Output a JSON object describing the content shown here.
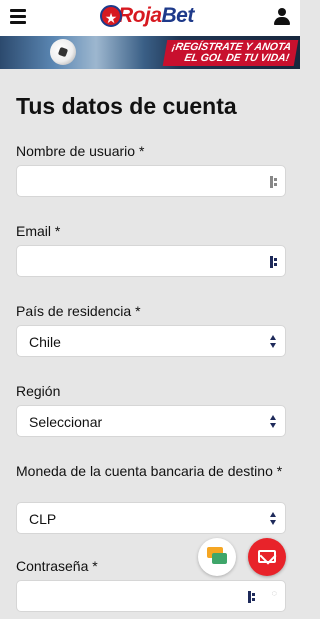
{
  "header": {
    "brand_roja": "Roja",
    "brand_bet": "Bet"
  },
  "banner": {
    "line1": "¡REGÍSTRATE Y ANOTA",
    "line2": "EL GOL DE TU VIDA!"
  },
  "form": {
    "title": "Tus datos de cuenta",
    "username_label": "Nombre de usuario *",
    "username_value": "",
    "email_label": "Email *",
    "email_value": "",
    "country_label": "País de residencia *",
    "country_value": "Chile",
    "region_label": "Región",
    "region_value": "Seleccionar",
    "currency_label": "Moneda de la cuenta bancaria de destino *",
    "currency_value": "CLP",
    "password_label": "Contraseña *",
    "password_value": ""
  },
  "icons": {
    "menu": "hamburger-menu-icon",
    "user": "user-icon",
    "chat": "chat-bubbles-icon",
    "mail": "envelope-icon",
    "password_manager": "password-manager-icon",
    "visibility": "eye-off-icon"
  },
  "colors": {
    "brand_red": "#d71920",
    "brand_blue": "#1e3a8a",
    "background": "#e6e6e6",
    "mail_fab": "#e8232a"
  }
}
